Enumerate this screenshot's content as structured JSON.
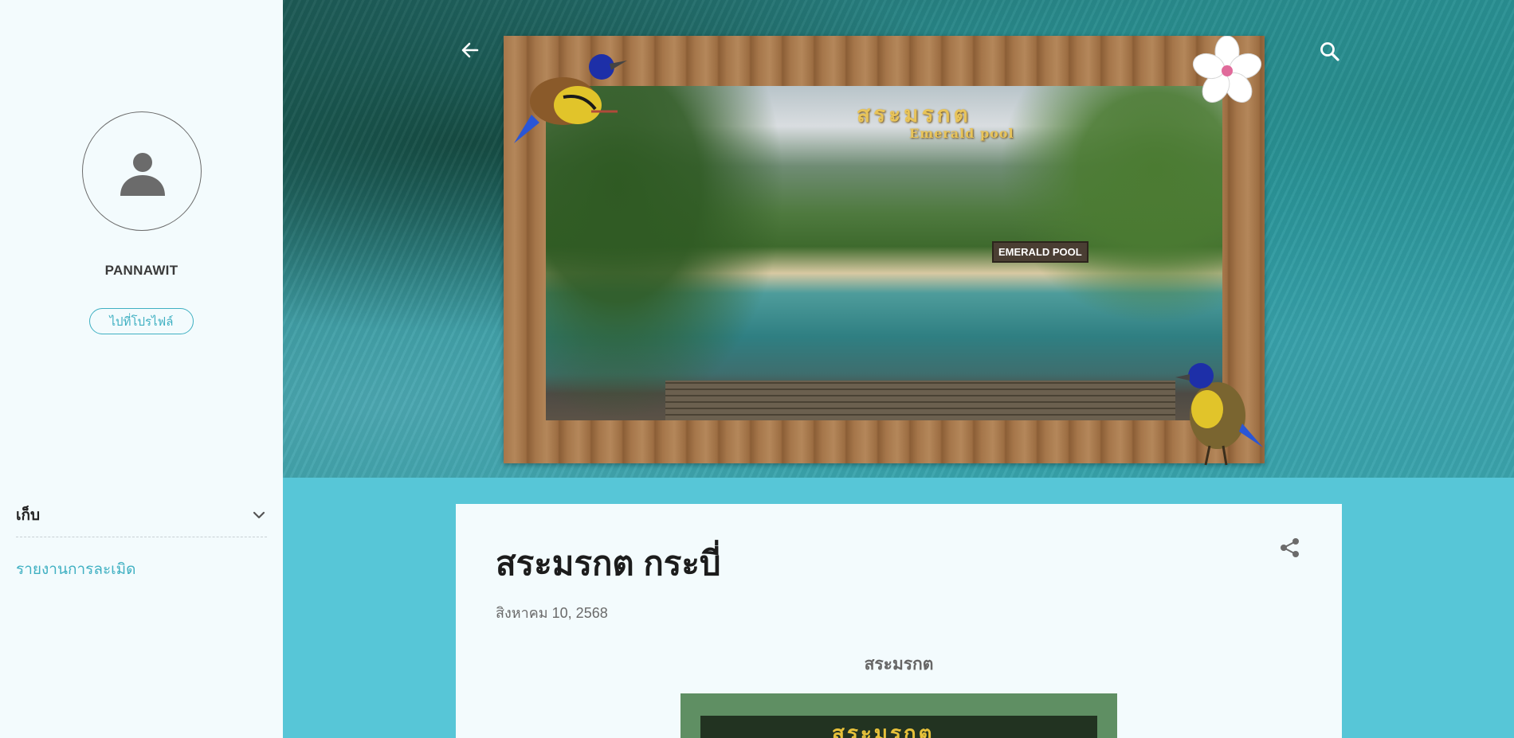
{
  "sidebar": {
    "profile_name": "PANNAWIT",
    "profile_button": "ไปที่โปรไฟล์",
    "archive_label": "เก็บ",
    "report_link": "รายงานการละเมิด"
  },
  "header": {
    "photo_title": "สระมรกต",
    "photo_subtitle": "Emerald pool",
    "photo_sign": "EMERALD POOL"
  },
  "post": {
    "title": "สระมรกต กระบี่",
    "date": "สิงหาคม 10, 2568",
    "heading": "สระมรกต",
    "image_title": "สระมรกต"
  },
  "colors": {
    "accent": "#3fb0c2",
    "page_bg": "#57c6d7",
    "panel_bg": "#f3fbfd"
  },
  "icons": [
    "arrow-left-icon",
    "search-icon",
    "person-icon",
    "chevron-down-icon",
    "share-icon"
  ]
}
